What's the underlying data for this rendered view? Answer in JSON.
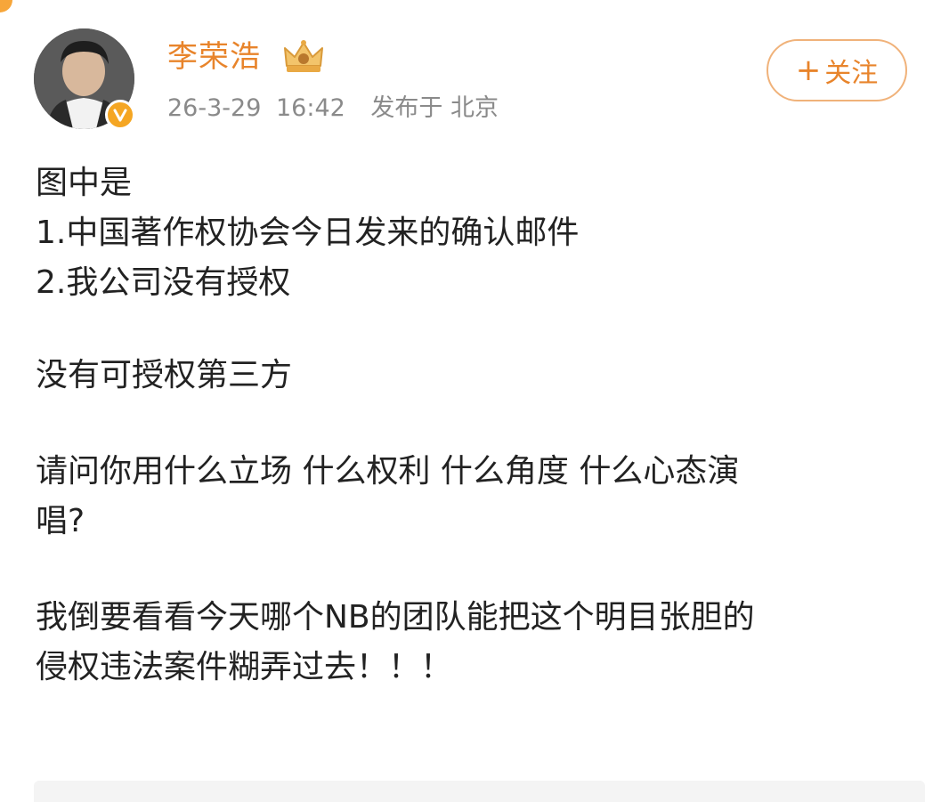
{
  "user": {
    "name": "李荣浩",
    "badge_icon": "verified-v-icon",
    "crown_icon": "crown-icon"
  },
  "meta": {
    "date": "26-3-29",
    "time": "16:42",
    "location": "发布于 北京"
  },
  "follow": {
    "plus": "+",
    "label": "关注"
  },
  "post": {
    "lines_block1": [
      "图中是",
      "1.中国著作权协会今日发来的确认邮件",
      "2.我公司没有授权"
    ],
    "line_block2": "没有可授权第三方",
    "block3_line1": "请问你用什么立场 什么权利 什么角度 什么心态演",
    "block3_line2": "唱?",
    "block4_line1": "我倒要看看今天哪个NB的团队能把这个明目张胆的",
    "block4_line2": "侵权违法案件糊弄过去！！！"
  },
  "colors": {
    "accent": "#e8842b",
    "meta_gray": "#8a8a8a",
    "text": "#222222"
  }
}
